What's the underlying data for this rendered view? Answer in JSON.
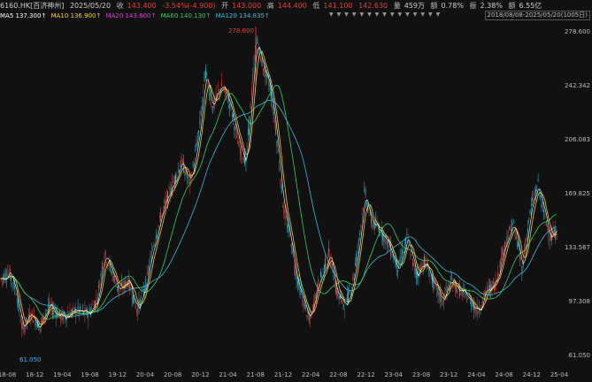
{
  "header": {
    "symbol": "6160.HK[百济神州]",
    "date": "2025/05/20",
    "close_label": "收",
    "close": "143.400",
    "change": "-3.54%(-4.900)",
    "open_label": "开",
    "open": "143.000",
    "high_label": "高",
    "high": "144.400",
    "low_label": "低",
    "low": "141.100",
    "mid": "142.630",
    "vol_label": "量",
    "vol": "459万",
    "amp_label": "额",
    "amp": "0.78%",
    "turn_label": "振",
    "turn": "2.38%",
    "amount_label": "额",
    "amount": "6.55亿"
  },
  "ma": {
    "ma5": "MA5 137.300↑",
    "ma10": "MA10 136.900↑",
    "ma20": "MA20 143.600↑",
    "ma60": "MA60 140.130↑",
    "ma120": "MA120 134.835↑"
  },
  "range_text": "2018/08/08-2025/05/20(1005日)",
  "y_ticks": [
    "278.600",
    "242.342",
    "206.083",
    "169.825",
    "133.567",
    "97.308",
    "61.050"
  ],
  "x_ticks": [
    "18-08",
    "18-12",
    "19-04",
    "19-08",
    "19-12",
    "20-04",
    "20-08",
    "20-12",
    "21-04",
    "21-08",
    "21-12",
    "22-04",
    "22-08",
    "22-12",
    "23-04",
    "23-08",
    "23-12",
    "24-04",
    "24-08",
    "24-12",
    "25-04"
  ],
  "markers": {
    "high": "278.600",
    "low": "61.050"
  },
  "colors": {
    "bg": "#111111",
    "up": "#e0413a",
    "ma5": "#ffffff",
    "ma10": "#f0d020",
    "ma20": "#e040e0",
    "ma60": "#30d060",
    "ma120": "#3fb8d8"
  }
}
